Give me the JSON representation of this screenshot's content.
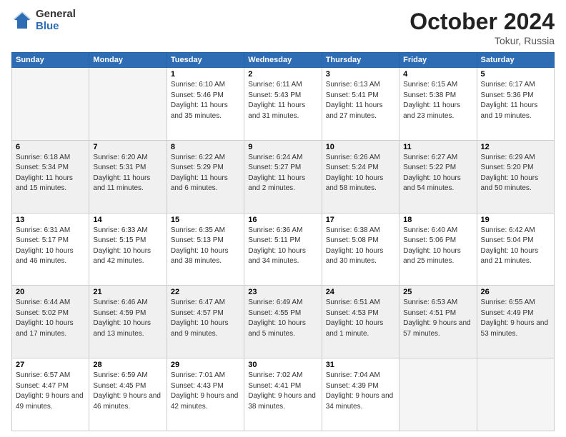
{
  "header": {
    "logo_general": "General",
    "logo_blue": "Blue",
    "month_title": "October 2024",
    "location": "Tokur, Russia"
  },
  "weekdays": [
    "Sunday",
    "Monday",
    "Tuesday",
    "Wednesday",
    "Thursday",
    "Friday",
    "Saturday"
  ],
  "weeks": [
    [
      {
        "day": "",
        "info": ""
      },
      {
        "day": "",
        "info": ""
      },
      {
        "day": "1",
        "info": "Sunrise: 6:10 AM\nSunset: 5:46 PM\nDaylight: 11 hours and 35 minutes."
      },
      {
        "day": "2",
        "info": "Sunrise: 6:11 AM\nSunset: 5:43 PM\nDaylight: 11 hours and 31 minutes."
      },
      {
        "day": "3",
        "info": "Sunrise: 6:13 AM\nSunset: 5:41 PM\nDaylight: 11 hours and 27 minutes."
      },
      {
        "day": "4",
        "info": "Sunrise: 6:15 AM\nSunset: 5:38 PM\nDaylight: 11 hours and 23 minutes."
      },
      {
        "day": "5",
        "info": "Sunrise: 6:17 AM\nSunset: 5:36 PM\nDaylight: 11 hours and 19 minutes."
      }
    ],
    [
      {
        "day": "6",
        "info": "Sunrise: 6:18 AM\nSunset: 5:34 PM\nDaylight: 11 hours and 15 minutes."
      },
      {
        "day": "7",
        "info": "Sunrise: 6:20 AM\nSunset: 5:31 PM\nDaylight: 11 hours and 11 minutes."
      },
      {
        "day": "8",
        "info": "Sunrise: 6:22 AM\nSunset: 5:29 PM\nDaylight: 11 hours and 6 minutes."
      },
      {
        "day": "9",
        "info": "Sunrise: 6:24 AM\nSunset: 5:27 PM\nDaylight: 11 hours and 2 minutes."
      },
      {
        "day": "10",
        "info": "Sunrise: 6:26 AM\nSunset: 5:24 PM\nDaylight: 10 hours and 58 minutes."
      },
      {
        "day": "11",
        "info": "Sunrise: 6:27 AM\nSunset: 5:22 PM\nDaylight: 10 hours and 54 minutes."
      },
      {
        "day": "12",
        "info": "Sunrise: 6:29 AM\nSunset: 5:20 PM\nDaylight: 10 hours and 50 minutes."
      }
    ],
    [
      {
        "day": "13",
        "info": "Sunrise: 6:31 AM\nSunset: 5:17 PM\nDaylight: 10 hours and 46 minutes."
      },
      {
        "day": "14",
        "info": "Sunrise: 6:33 AM\nSunset: 5:15 PM\nDaylight: 10 hours and 42 minutes."
      },
      {
        "day": "15",
        "info": "Sunrise: 6:35 AM\nSunset: 5:13 PM\nDaylight: 10 hours and 38 minutes."
      },
      {
        "day": "16",
        "info": "Sunrise: 6:36 AM\nSunset: 5:11 PM\nDaylight: 10 hours and 34 minutes."
      },
      {
        "day": "17",
        "info": "Sunrise: 6:38 AM\nSunset: 5:08 PM\nDaylight: 10 hours and 30 minutes."
      },
      {
        "day": "18",
        "info": "Sunrise: 6:40 AM\nSunset: 5:06 PM\nDaylight: 10 hours and 25 minutes."
      },
      {
        "day": "19",
        "info": "Sunrise: 6:42 AM\nSunset: 5:04 PM\nDaylight: 10 hours and 21 minutes."
      }
    ],
    [
      {
        "day": "20",
        "info": "Sunrise: 6:44 AM\nSunset: 5:02 PM\nDaylight: 10 hours and 17 minutes."
      },
      {
        "day": "21",
        "info": "Sunrise: 6:46 AM\nSunset: 4:59 PM\nDaylight: 10 hours and 13 minutes."
      },
      {
        "day": "22",
        "info": "Sunrise: 6:47 AM\nSunset: 4:57 PM\nDaylight: 10 hours and 9 minutes."
      },
      {
        "day": "23",
        "info": "Sunrise: 6:49 AM\nSunset: 4:55 PM\nDaylight: 10 hours and 5 minutes."
      },
      {
        "day": "24",
        "info": "Sunrise: 6:51 AM\nSunset: 4:53 PM\nDaylight: 10 hours and 1 minute."
      },
      {
        "day": "25",
        "info": "Sunrise: 6:53 AM\nSunset: 4:51 PM\nDaylight: 9 hours and 57 minutes."
      },
      {
        "day": "26",
        "info": "Sunrise: 6:55 AM\nSunset: 4:49 PM\nDaylight: 9 hours and 53 minutes."
      }
    ],
    [
      {
        "day": "27",
        "info": "Sunrise: 6:57 AM\nSunset: 4:47 PM\nDaylight: 9 hours and 49 minutes."
      },
      {
        "day": "28",
        "info": "Sunrise: 6:59 AM\nSunset: 4:45 PM\nDaylight: 9 hours and 46 minutes."
      },
      {
        "day": "29",
        "info": "Sunrise: 7:01 AM\nSunset: 4:43 PM\nDaylight: 9 hours and 42 minutes."
      },
      {
        "day": "30",
        "info": "Sunrise: 7:02 AM\nSunset: 4:41 PM\nDaylight: 9 hours and 38 minutes."
      },
      {
        "day": "31",
        "info": "Sunrise: 7:04 AM\nSunset: 4:39 PM\nDaylight: 9 hours and 34 minutes."
      },
      {
        "day": "",
        "info": ""
      },
      {
        "day": "",
        "info": ""
      }
    ]
  ]
}
